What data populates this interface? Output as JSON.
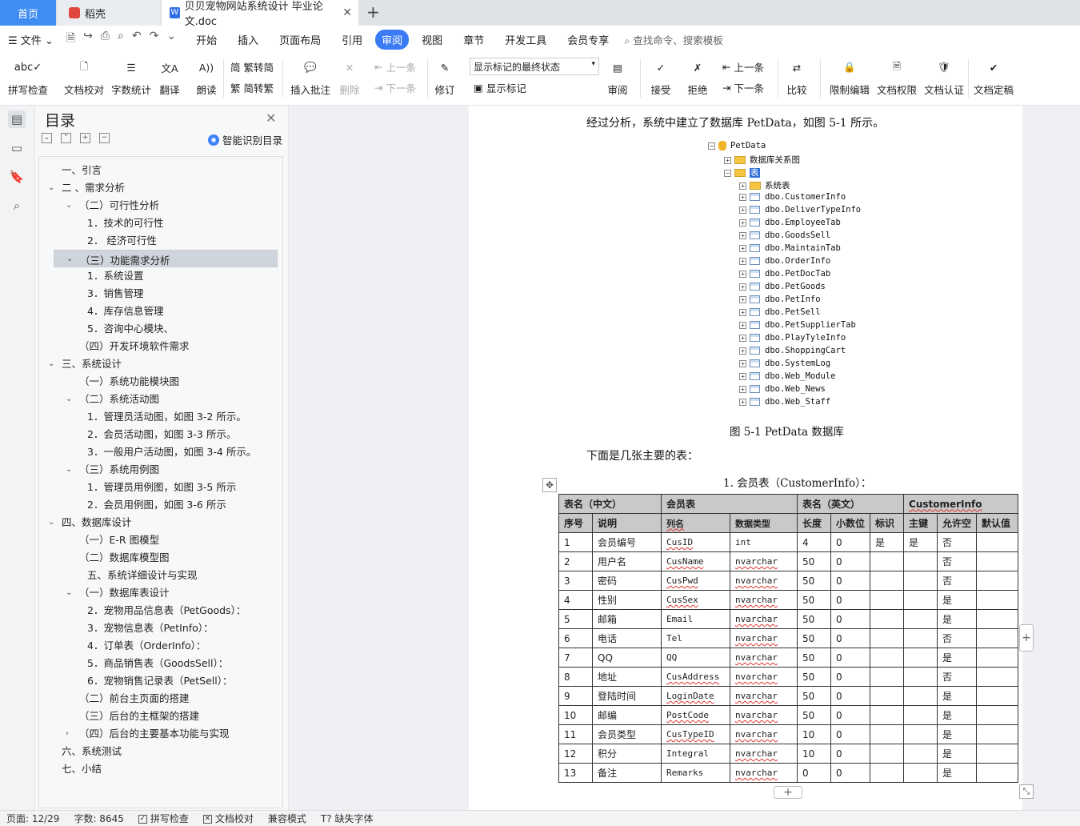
{
  "tabs": {
    "home": "首页",
    "shell": "稻壳",
    "doc": "贝贝宠物网站系统设计 毕业论文.doc"
  },
  "menu": {
    "file": "文件",
    "items": [
      "开始",
      "插入",
      "页面布局",
      "引用",
      "审阅",
      "视图",
      "章节",
      "开发工具",
      "会员专享"
    ],
    "active": "审阅",
    "search": "查找命令、搜索模板"
  },
  "ribbon": {
    "spell": "拼写检查",
    "proof": "文档校对",
    "wordcount": "字数统计",
    "translate": "翻译",
    "read": "朗读",
    "trad": "繁转简",
    "simp": "简转繁",
    "insert_comment": "插入批注",
    "delete": "删除",
    "prev": "上一条",
    "next": "下一条",
    "revise": "修订",
    "markup_select": "显示标记的最终状态",
    "show_markup": "显示标记",
    "review": "审阅",
    "accept": "接受",
    "reject": "拒绝",
    "prev2": "上一条",
    "next2": "下一条",
    "compare": "比较",
    "restrict": "限制编辑",
    "perm": "文档权限",
    "auth": "文档认证",
    "final": "文档定稿"
  },
  "toc": {
    "title": "目录",
    "smart": "智能识别目录",
    "items": [
      {
        "t": "一、引言",
        "l": 0,
        "a": ""
      },
      {
        "t": "二 、需求分析",
        "l": 0,
        "a": "v"
      },
      {
        "t": "（二）可行性分析",
        "l": 1,
        "a": "v"
      },
      {
        "t": "1．技术的可行性",
        "l": 2,
        "a": ""
      },
      {
        "t": "2．  经济可行性",
        "l": 2,
        "a": ""
      },
      {
        "t": "（三）功能需求分析",
        "l": 1,
        "a": "v",
        "sel": true
      },
      {
        "t": "1．系统设置",
        "l": 2,
        "a": ""
      },
      {
        "t": "3．销售管理",
        "l": 2,
        "a": ""
      },
      {
        "t": "4．库存信息管理",
        "l": 2,
        "a": ""
      },
      {
        "t": "5．咨询中心模块、",
        "l": 2,
        "a": ""
      },
      {
        "t": "（四）开发环境软件需求",
        "l": 1,
        "a": ""
      },
      {
        "t": "三、系统设计",
        "l": 0,
        "a": "v"
      },
      {
        "t": "（一）系统功能模块图",
        "l": 1,
        "a": ""
      },
      {
        "t": "（二）系统活动图",
        "l": 1,
        "a": "v"
      },
      {
        "t": "1．管理员活动图，如图 3-2 所示。",
        "l": 2,
        "a": ""
      },
      {
        "t": "2．会员活动图，如图 3-3 所示。",
        "l": 2,
        "a": ""
      },
      {
        "t": "3．一般用户活动图，如图 3-4 所示。",
        "l": 2,
        "a": ""
      },
      {
        "t": "（三）系统用例图",
        "l": 1,
        "a": "v"
      },
      {
        "t": "1．管理员用例图，如图 3-5 所示",
        "l": 2,
        "a": ""
      },
      {
        "t": "2．会员用例图，如图 3-6 所示",
        "l": 2,
        "a": ""
      },
      {
        "t": "四、数据库设计",
        "l": 0,
        "a": "v"
      },
      {
        "t": "（一）E-R 图模型",
        "l": 1,
        "a": ""
      },
      {
        "t": "（二）数据库模型图",
        "l": 1,
        "a": ""
      },
      {
        "t": "五、系统详细设计与实现",
        "l": 2,
        "a": ""
      },
      {
        "t": "（一）数据库表设计",
        "l": 1,
        "a": "v"
      },
      {
        "t": "2．宠物用品信息表（PetGoods）：",
        "l": 2,
        "a": ""
      },
      {
        "t": "3．宠物信息表（PetInfo）：",
        "l": 2,
        "a": ""
      },
      {
        "t": "4．订单表（OrderInfo）：",
        "l": 2,
        "a": ""
      },
      {
        "t": "5．商品销售表（GoodsSell）：",
        "l": 2,
        "a": ""
      },
      {
        "t": "6．宠物销售记录表（PetSell）：",
        "l": 2,
        "a": ""
      },
      {
        "t": "（二）前台主页面的搭建",
        "l": 1,
        "a": ""
      },
      {
        "t": "（三）后台的主框架的搭建",
        "l": 1,
        "a": ""
      },
      {
        "t": "（四）后台的主要基本功能与实现",
        "l": 1,
        "a": ">"
      },
      {
        "t": "六、系统测试",
        "l": 0,
        "a": ""
      },
      {
        "t": "七、小结",
        "l": 0,
        "a": ""
      }
    ]
  },
  "doc": {
    "intro": "经过分析，系统中建立了数据库 PetData，如图 5-1 所示。",
    "tree_root": "PetData",
    "tree_diagram": "数据库关系图",
    "tree_tables": "表",
    "tree_sys": "系统表",
    "tables": [
      "dbo.CustomerInfo",
      "dbo.DeliverTypeInfo",
      "dbo.EmployeeTab",
      "dbo.GoodsSell",
      "dbo.MaintainTab",
      "dbo.OrderInfo",
      "dbo.PetDocTab",
      "dbo.PetGoods",
      "dbo.PetInfo",
      "dbo.PetSell",
      "dbo.PetSupplierTab",
      "dbo.PlayTyleInfo",
      "dbo.ShoppingCart",
      "dbo.SystemLog",
      "dbo.Web_Module",
      "dbo.Web_News",
      "dbo.Web_Staff"
    ],
    "caption": "图 5-1 PetData 数据库",
    "para2": "下面是几张主要的表：",
    "heading": "1. 会员表（CustomerInfo）：",
    "table_head1": [
      "表名（中文）",
      "会员表",
      "表名（英文）",
      "CustomerInfo"
    ],
    "table_head2": [
      "序号",
      "说明",
      "列名",
      "数据类型",
      "长度",
      "小数位",
      "标识",
      "主键",
      "允许空",
      "默认值"
    ],
    "rows": [
      [
        "1",
        "会员编号",
        "CusID",
        "int",
        "4",
        "0",
        "是",
        "是",
        "否",
        ""
      ],
      [
        "2",
        "用户名",
        "CusName",
        "nvarchar",
        "50",
        "0",
        "",
        "",
        "否",
        ""
      ],
      [
        "3",
        "密码",
        "CusPwd",
        "nvarchar",
        "50",
        "0",
        "",
        "",
        "否",
        ""
      ],
      [
        "4",
        "性别",
        "CusSex",
        "nvarchar",
        "50",
        "0",
        "",
        "",
        "是",
        ""
      ],
      [
        "5",
        "邮箱",
        "Email",
        "nvarchar",
        "50",
        "0",
        "",
        "",
        "是",
        ""
      ],
      [
        "6",
        "电话",
        "Tel",
        "nvarchar",
        "50",
        "0",
        "",
        "",
        "否",
        ""
      ],
      [
        "7",
        "QQ",
        "QQ",
        "nvarchar",
        "50",
        "0",
        "",
        "",
        "是",
        ""
      ],
      [
        "8",
        "地址",
        "CusAddress",
        "nvarchar",
        "50",
        "0",
        "",
        "",
        "否",
        ""
      ],
      [
        "9",
        "登陆时间",
        "LoginDate",
        "nvarchar",
        "50",
        "0",
        "",
        "",
        "是",
        ""
      ],
      [
        "10",
        "邮编",
        "PostCode",
        "nvarchar",
        "50",
        "0",
        "",
        "",
        "是",
        ""
      ],
      [
        "11",
        "会员类型",
        "CusTypeID",
        "nvarchar",
        "10",
        "0",
        "",
        "",
        "是",
        ""
      ],
      [
        "12",
        "积分",
        "Integral",
        "nvarchar",
        "10",
        "0",
        "",
        "",
        "是",
        ""
      ],
      [
        "13",
        "备注",
        "Remarks",
        "nvarchar",
        "0",
        "0",
        "",
        "",
        "是",
        ""
      ]
    ]
  },
  "status": {
    "page": "页面: 12/29",
    "words": "字数: 8645",
    "spell": "拼写检查",
    "proof": "文档校对",
    "compat": "兼容模式",
    "missing_font": "缺失字体"
  }
}
